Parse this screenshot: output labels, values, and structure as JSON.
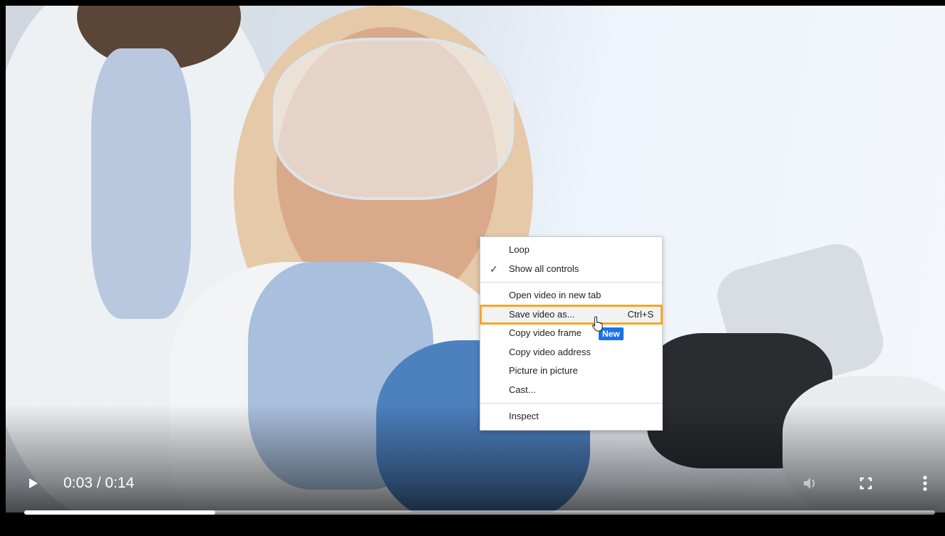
{
  "player": {
    "current_time": "0:03",
    "separator": " / ",
    "duration": "0:14",
    "progress": 0.21
  },
  "context_menu": {
    "items": [
      {
        "label": "Loop",
        "checked": false
      },
      {
        "label": "Show all controls",
        "checked": true
      },
      {
        "label": "Open video in new tab"
      },
      {
        "label": "Save video as...",
        "shortcut": "Ctrl+S",
        "highlighted": true
      },
      {
        "label": "Copy video frame",
        "badge": "New"
      },
      {
        "label": "Copy video address"
      },
      {
        "label": "Picture in picture"
      },
      {
        "label": "Cast..."
      },
      {
        "label": "Inspect"
      }
    ],
    "check_glyph": "✓"
  },
  "colors": {
    "highlight_outline": "#f5a623",
    "badge": "#1a73e8"
  },
  "icons": [
    "play-icon",
    "volume-icon",
    "fullscreen-icon",
    "more-vert-icon",
    "mouse-cursor-icon"
  ]
}
